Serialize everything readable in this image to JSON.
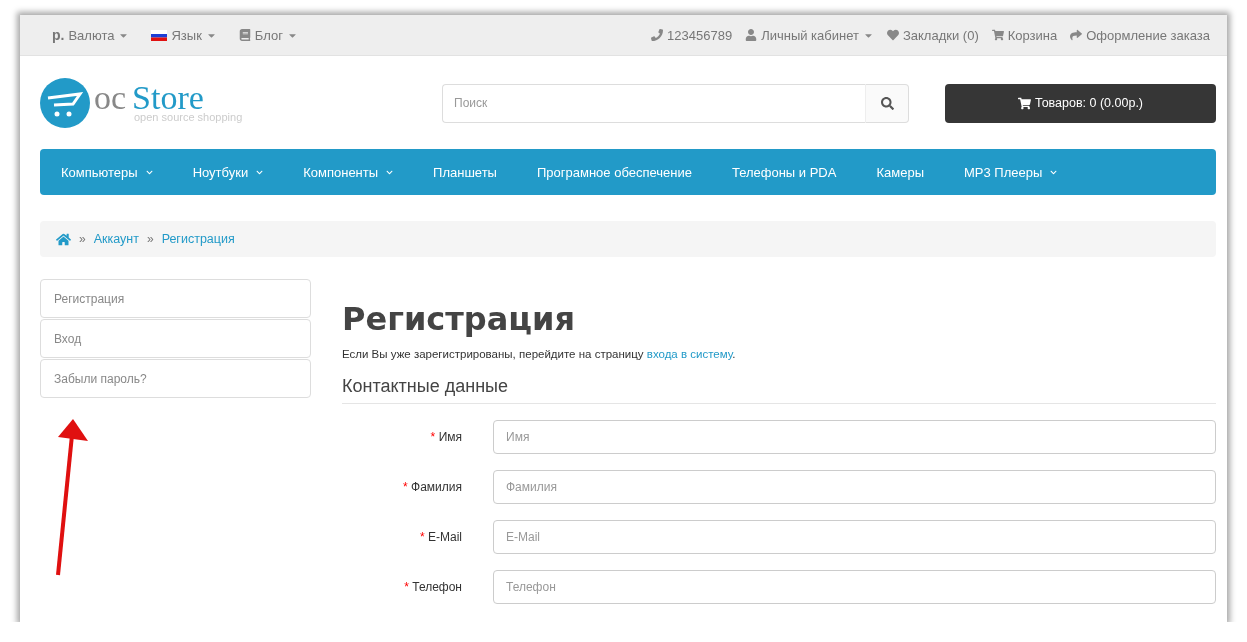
{
  "top_bar": {
    "left": [
      {
        "kind": "currency",
        "symbol": "р.",
        "label": "Валюта"
      },
      {
        "kind": "language",
        "label": "Язык"
      },
      {
        "kind": "blog",
        "label": "Блог"
      }
    ],
    "right": [
      {
        "kind": "phone",
        "label": "123456789",
        "dropdown": false
      },
      {
        "kind": "user",
        "label": "Личный кабинет",
        "dropdown": true
      },
      {
        "kind": "heart",
        "label": "Закладки (0)",
        "dropdown": false
      },
      {
        "kind": "cart",
        "label": "Корзина",
        "dropdown": false
      },
      {
        "kind": "share",
        "label": "Оформление заказа",
        "dropdown": false
      }
    ]
  },
  "logo": {
    "part1": "oc",
    "part2": "Store",
    "tagline": "open source shopping"
  },
  "search": {
    "placeholder": "Поиск"
  },
  "cart_button": {
    "label": "Товаров: 0 (0.00р.)"
  },
  "menu": [
    {
      "label": "Компьютеры",
      "dropdown": true
    },
    {
      "label": "Ноутбуки",
      "dropdown": true
    },
    {
      "label": "Компоненты",
      "dropdown": true
    },
    {
      "label": "Планшеты",
      "dropdown": false
    },
    {
      "label": "Програмное обеспечение",
      "dropdown": false
    },
    {
      "label": "Телефоны и PDA",
      "dropdown": false
    },
    {
      "label": "Камеры",
      "dropdown": false
    },
    {
      "label": "MP3 Плееры",
      "dropdown": true
    }
  ],
  "breadcrumb": [
    {
      "separator": "»",
      "label": "Аккаунт"
    },
    {
      "separator": "»",
      "label": "Регистрация"
    }
  ],
  "required_mark": "*",
  "sidebar": {
    "items": [
      "Регистрация",
      "Вход",
      "Забыли пароль?"
    ]
  },
  "page": {
    "title": "Регистрация",
    "intro": "Если Вы уже зарегистрированы, перейдите на страницу ",
    "intro_link": "входа в систему",
    "intro_end": ".",
    "section": "Контактные данные"
  },
  "fields": [
    {
      "label": "Имя",
      "placeholder": "Имя",
      "required": true
    },
    {
      "label": "Фамилия",
      "placeholder": "Фамилия",
      "required": true
    },
    {
      "label": "E-Mail",
      "placeholder": "E-Mail",
      "required": true
    },
    {
      "label": "Телефон",
      "placeholder": "Телефон",
      "required": true
    }
  ]
}
